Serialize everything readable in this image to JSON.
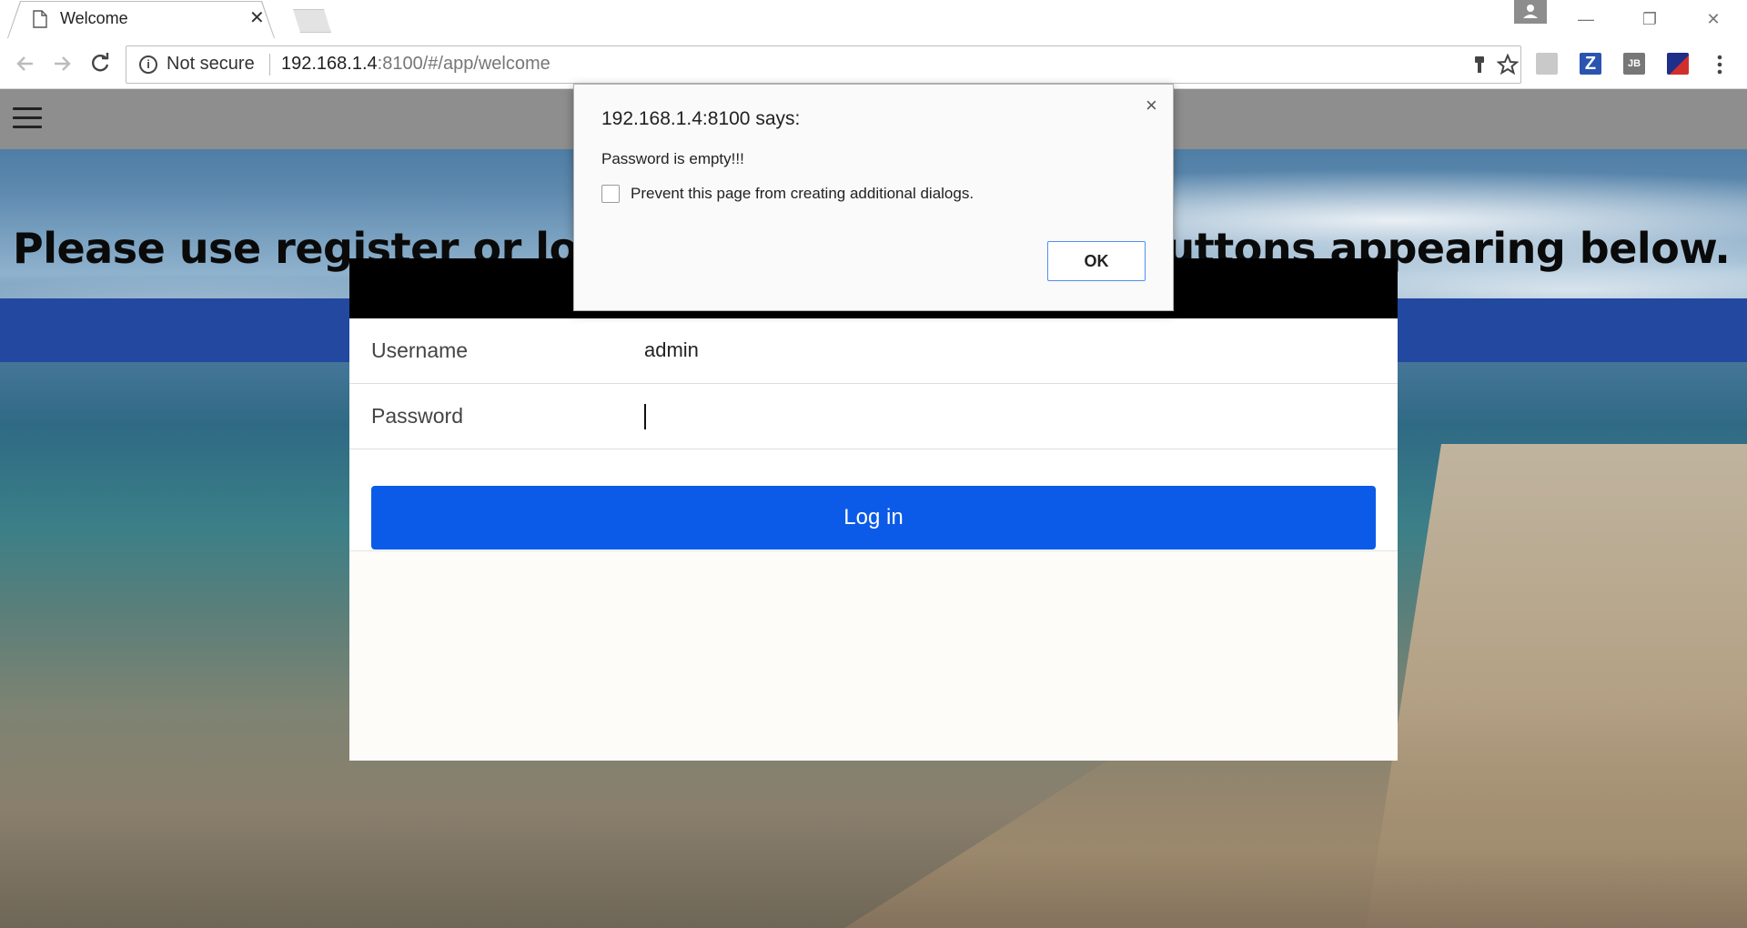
{
  "browser": {
    "tab_title": "Welcome",
    "security_label": "Not secure",
    "url_host": "192.168.1.4",
    "url_rest": ":8100/#/app/welcome"
  },
  "page": {
    "headline": "Please use register or login options by pressing buttons appearing below.",
    "login": {
      "username_label": "Username",
      "username_value": "admin",
      "password_label": "Password",
      "login_button": "Log in"
    }
  },
  "dialog": {
    "title": "192.168.1.4:8100 says:",
    "message": "Password is empty!!!",
    "checkbox_label": "Prevent this page from creating additional dialogs.",
    "ok_label": "OK"
  },
  "icons": {
    "tab_favicon": "page-icon",
    "tab_close": "close-icon",
    "back": "back-arrow-icon",
    "forward": "forward-arrow-icon",
    "reload": "reload-icon",
    "info": "info-icon",
    "key": "key-icon",
    "star": "star-icon",
    "menu": "hamburger-icon"
  },
  "colors": {
    "login_button": "#0b5be8",
    "header_band": "#2348a0",
    "app_header": "#8e8e8e"
  }
}
